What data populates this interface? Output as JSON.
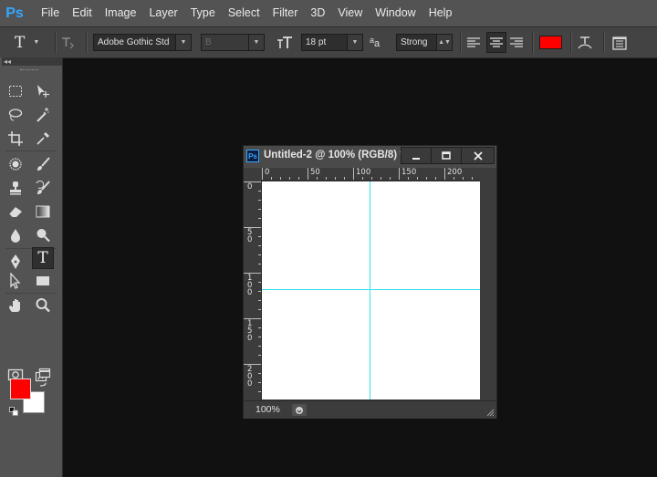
{
  "app": {
    "logo_text": "Ps"
  },
  "menu": {
    "items": [
      "File",
      "Edit",
      "Image",
      "Layer",
      "Type",
      "Select",
      "Filter",
      "3D",
      "View",
      "Window",
      "Help"
    ]
  },
  "options_bar": {
    "font_family": "Adobe Gothic Std",
    "font_style": "B",
    "font_size": "18 pt",
    "antialias_glyph": "a",
    "antialias": "Strong",
    "text_color": "#ff0000",
    "tool_glyph": "T"
  },
  "tools": {
    "collapse_label": "◂◂",
    "foreground_color": "#ff0000",
    "background_color": "#ffffff",
    "type_tool_glyph": "T"
  },
  "document": {
    "icon_text": "Ps",
    "title": "Untitled-2 @ 100% (RGB/8) *",
    "zoom": "100%",
    "ruler_top_labels": [
      "0",
      "50",
      "100",
      "150",
      "200"
    ],
    "ruler_left_labels": [
      "0",
      "50",
      "100",
      "150",
      "200"
    ],
    "guide_color": "#2de4ee",
    "canvas_color": "#ffffff"
  }
}
